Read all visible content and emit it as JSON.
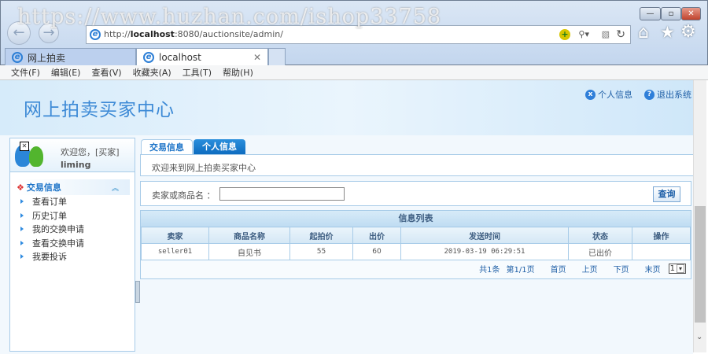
{
  "watermark": "https://www.huzhan.com/ishop33758",
  "browser": {
    "address": {
      "prefix": "http://",
      "host": "localhost",
      "rest": ":8080/auctionsite/admin/"
    },
    "tabs": [
      {
        "label": "网上拍卖"
      },
      {
        "label": "localhost"
      }
    ],
    "menu": [
      "文件(F)",
      "编辑(E)",
      "查看(V)",
      "收藏夹(A)",
      "工具(T)",
      "帮助(H)"
    ]
  },
  "header": {
    "title": "网上拍卖买家中心",
    "links": [
      {
        "label": "个人信息",
        "icon": "x"
      },
      {
        "label": "退出系统",
        "icon": "?"
      }
    ]
  },
  "sidebar": {
    "welcome": "欢迎您，[买家]",
    "username": "liming",
    "section": "交易信息",
    "items": [
      "查看订单",
      "历史订单",
      "我的交换申请",
      "查看交换申请",
      "我要投诉"
    ]
  },
  "main": {
    "tabs": [
      "交易信息",
      "个人信息"
    ],
    "welcome": "欢迎来到网上拍卖买家中心",
    "search": {
      "label": "卖家或商品名 ：",
      "value": "",
      "button": "查询"
    },
    "table": {
      "title": "信息列表",
      "headers": [
        "卖家",
        "商品名称",
        "起拍价",
        "出价",
        "发送时间",
        "状态",
        "操作"
      ],
      "rows": [
        [
          "seller01",
          "自见书",
          "55",
          "60",
          "2019-03-19 06:29:51",
          "已出价",
          ""
        ]
      ]
    },
    "pager": {
      "total": "共1条",
      "page": "第1/1页",
      "first": "首页",
      "prev": "上页",
      "next": "下页",
      "last": "末页",
      "select": "1"
    }
  }
}
